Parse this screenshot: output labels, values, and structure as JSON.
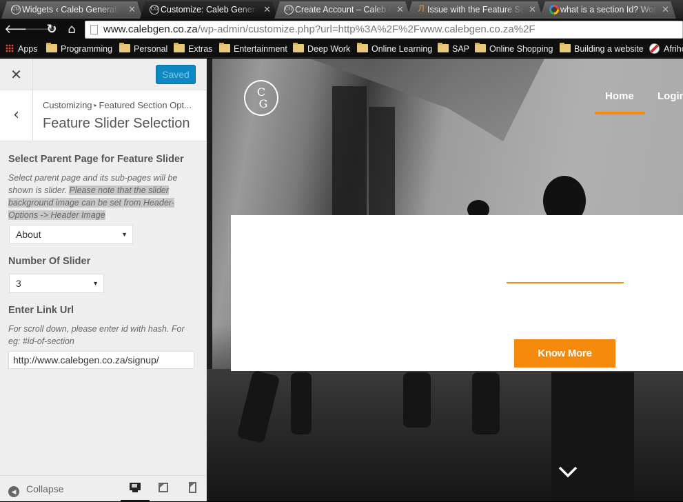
{
  "browser": {
    "tabs": [
      {
        "title": "Widgets ‹ Caleb Generation",
        "icon": "site-favicon",
        "active": false
      },
      {
        "title": "Customize: Caleb Generation",
        "icon": "site-favicon",
        "active": true
      },
      {
        "title": "Create Account – Caleb Generation",
        "icon": "site-favicon",
        "active": false
      },
      {
        "title": "Issue with the Feature Section",
        "icon": "accesspress-favicon",
        "active": false
      },
      {
        "title": "what is a section Id? WordPress",
        "icon": "google-favicon",
        "active": false
      }
    ],
    "tab_close_glyph": "✕",
    "favicon_text": "CG",
    "af_glyph": "Л",
    "nav": {
      "back": "🡐",
      "forward": "🡒",
      "reload": "↻",
      "home": "⌂"
    },
    "url": {
      "host": "www.calebgen.co.za",
      "path": "/wp-admin/customize.php?url=http%3A%2F%2Fwww.calebgen.co.za%2F"
    },
    "bookmarks": [
      {
        "label": "Apps",
        "icon": "apps-grid-icon"
      },
      {
        "label": "Programming",
        "icon": "folder-icon"
      },
      {
        "label": "Personal",
        "icon": "folder-icon"
      },
      {
        "label": "Extras",
        "icon": "folder-icon"
      },
      {
        "label": "Entertainment",
        "icon": "folder-icon"
      },
      {
        "label": "Deep Work",
        "icon": "folder-icon"
      },
      {
        "label": "Online Learning",
        "icon": "folder-icon"
      },
      {
        "label": "SAP",
        "icon": "folder-icon"
      },
      {
        "label": "Online Shopping",
        "icon": "folder-icon"
      },
      {
        "label": "Building a website",
        "icon": "folder-icon"
      },
      {
        "label": "Afrihost",
        "icon": "afrihost-icon"
      }
    ]
  },
  "customizer": {
    "close_glyph": "✕",
    "save_button": "Saved",
    "back_glyph": "‹",
    "breadcrumb": {
      "root": "Customizing",
      "separator": "▸",
      "section": "Featured Section Opt..."
    },
    "section_title": "Feature Slider Selection",
    "controls": {
      "parent_page": {
        "label": "Select Parent Page for Feature Slider",
        "desc_plain": "Select parent page and its sub-pages will be shown is slider. ",
        "desc_highlight": "Please note that the slider background image can be set from Header-Options -> Header Image",
        "value": "About"
      },
      "slider_count": {
        "label": "Number Of Slider",
        "value": "3"
      },
      "link_url": {
        "label": "Enter Link Url",
        "desc": "For scroll down, please enter id with hash. For eg: #id-of-section",
        "value": "http://www.calebgen.co.za/signup/"
      }
    },
    "caret_glyph": "▼",
    "footer": {
      "collapse_label": "Collapse",
      "collapse_glyph": "◀",
      "active_device": "desktop"
    }
  },
  "preview": {
    "logo": {
      "line1": "C",
      "line2": "G"
    },
    "nav": [
      {
        "label": "Home",
        "active": true
      },
      {
        "label": "Login",
        "active": false
      }
    ],
    "cta_label": "Know More",
    "accent": "#f68a0c"
  },
  "colors": {
    "wp_blue": "#0e88c3",
    "accent_orange": "#f68a0c",
    "sidebar_bg": "#eeeeee"
  }
}
